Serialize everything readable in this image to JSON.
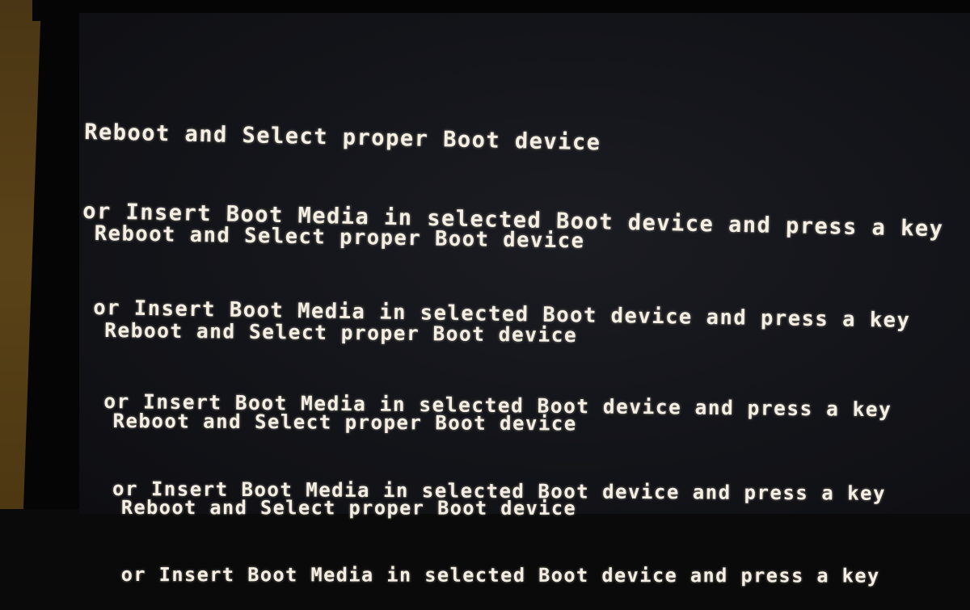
{
  "screen": {
    "type": "BIOS boot error",
    "messages": [
      {
        "line1": "Reboot and Select proper Boot device",
        "line2": "or Insert Boot Media in selected Boot device and press a key"
      },
      {
        "line1": "Reboot and Select proper Boot device",
        "line2": "or Insert Boot Media in selected Boot device and press a key"
      },
      {
        "line1": "Reboot and Select proper Boot device",
        "line2": "or Insert Boot Media in selected Boot device and press a key"
      },
      {
        "line1": "Reboot and Select proper Boot device",
        "line2": "or Insert Boot Media in selected Boot device and press a key"
      },
      {
        "line1": "Reboot and Select proper Boot device",
        "line2": "or Insert Boot Media in selected Boot device and press a key"
      }
    ]
  },
  "colors": {
    "text": "#f4efe2",
    "screen_bg": "#131419",
    "bezel": "#050505",
    "wall": "#4a3614"
  }
}
